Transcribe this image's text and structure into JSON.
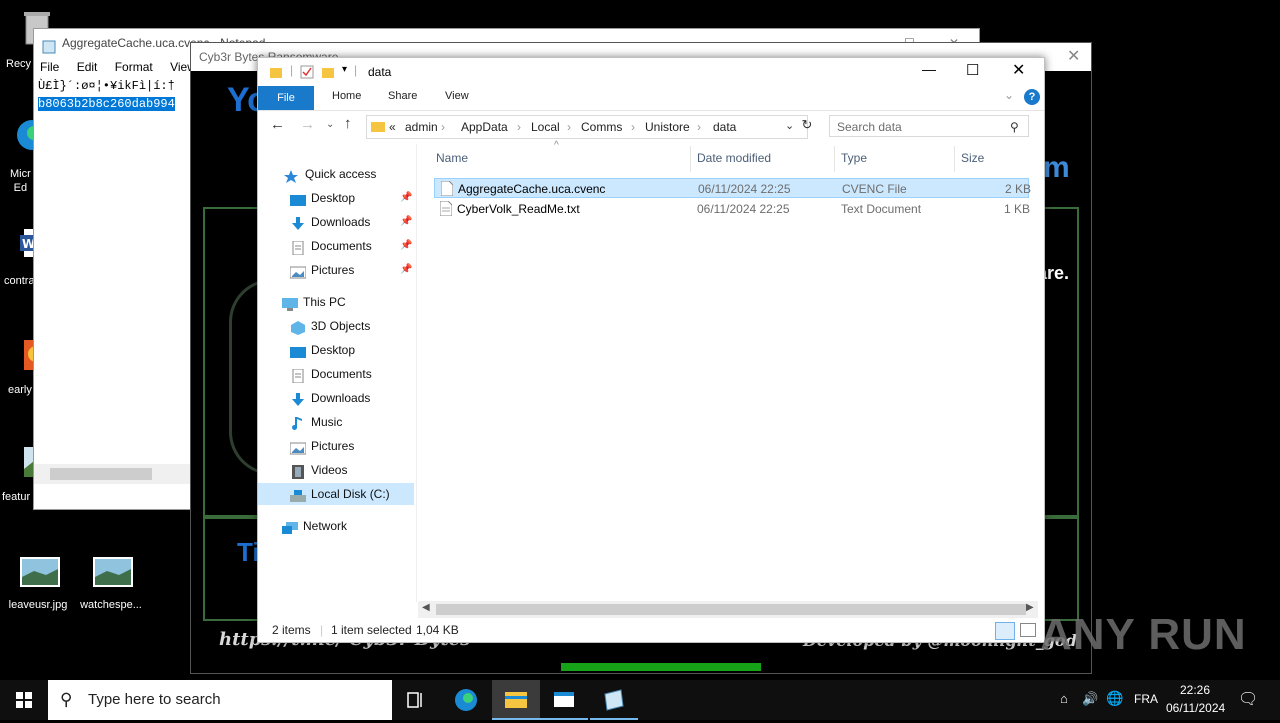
{
  "desktop": {
    "icons": [
      {
        "label": "Recy",
        "icon": "recycle-bin-icon"
      },
      {
        "label": "Micr\nEd",
        "icon": "edge-icon"
      },
      {
        "label": "contra",
        "icon": "word-icon"
      },
      {
        "label": "early",
        "icon": "image-icon"
      },
      {
        "label": "featur",
        "icon": "image-icon"
      },
      {
        "label": "leaveusr.jpg",
        "icon": "image-icon"
      },
      {
        "label": "watchespe...",
        "icon": "image-icon"
      }
    ]
  },
  "notepad": {
    "title": "AggregateCache.uca.cvenc - Notepad",
    "menu": [
      "File",
      "Edit",
      "Format",
      "View"
    ],
    "line1": "Ù£Ì}´:ø¤¦•¥ikFì|í:†",
    "line2": "b8063b2b8c260dab994"
  },
  "ransom": {
    "title": "Cyb3r Bytes Ransomware",
    "heading_fragment": "Yo",
    "right_fragment_top": "m",
    "right_fragment_mid": "are.",
    "bottom_fragment": "Ti",
    "footer_left": "https://t.me/ Cyb3r Bytes",
    "footer_right": "Developed by @moonlight_god"
  },
  "explorer": {
    "title": "data",
    "ribbon_tabs": [
      "File",
      "Home",
      "Share",
      "View"
    ],
    "breadcrumb": [
      "«",
      "admin",
      "AppData",
      "Local",
      "Comms",
      "Unistore",
      "data"
    ],
    "search_placeholder": "Search data",
    "nav": {
      "quick_access": "Quick access",
      "quick_items": [
        "Desktop",
        "Downloads",
        "Documents",
        "Pictures"
      ],
      "this_pc": "This PC",
      "pc_items": [
        "3D Objects",
        "Desktop",
        "Documents",
        "Downloads",
        "Music",
        "Pictures",
        "Videos",
        "Local Disk (C:)"
      ],
      "network": "Network"
    },
    "columns": [
      "Name",
      "Date modified",
      "Type",
      "Size"
    ],
    "files": [
      {
        "name": "AggregateCache.uca.cvenc",
        "date": "06/11/2024 22:25",
        "type": "CVENC File",
        "size": "2 KB"
      },
      {
        "name": "CyberVolk_ReadMe.txt",
        "date": "06/11/2024 22:25",
        "type": "Text Document",
        "size": "1 KB"
      }
    ],
    "status": {
      "count": "2 items",
      "selected": "1 item selected",
      "size": "1,04 KB"
    }
  },
  "taskbar": {
    "search_placeholder": "Type here to search",
    "lang": "FRA",
    "time": "22:26",
    "date": "06/11/2024"
  },
  "watermark": "ANY RUN"
}
